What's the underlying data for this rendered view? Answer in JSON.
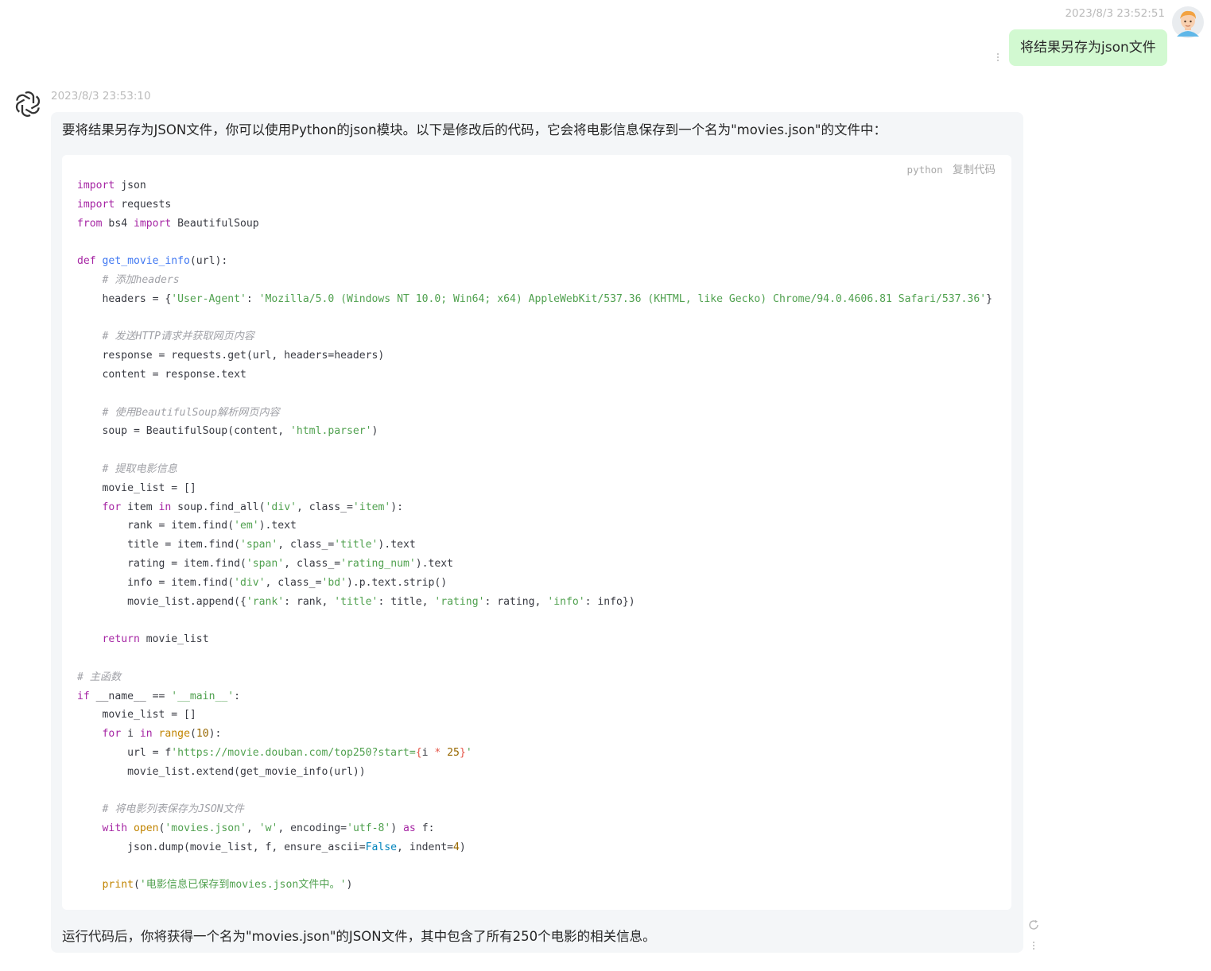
{
  "user_message": {
    "timestamp": "2023/8/3 23:52:51",
    "text": "将结果另存为json文件",
    "avatar_icon": "user-avatar-icon",
    "bubble_color": "#d2f9d1"
  },
  "assistant_message": {
    "timestamp": "2023/8/3 23:53:10",
    "avatar_icon": "openai-logo-icon",
    "intro": "要将结果另存为JSON文件，你可以使用Python的json模块。以下是修改后的代码，它会将电影信息保存到一个名为\"movies.json\"的文件中：",
    "code_block": {
      "language": "python",
      "copy_label": "复制代码",
      "lines": [
        "import json",
        "import requests",
        "from bs4 import BeautifulSoup",
        "",
        "def get_movie_info(url):",
        "    # 添加headers",
        "    headers = {'User-Agent': 'Mozilla/5.0 (Windows NT 10.0; Win64; x64) AppleWebKit/537.36 (KHTML, like Gecko) Chrome/94.0.4606.81 Safari/537.36'}",
        "",
        "    # 发送HTTP请求并获取网页内容",
        "    response = requests.get(url, headers=headers)",
        "    content = response.text",
        "",
        "    # 使用BeautifulSoup解析网页内容",
        "    soup = BeautifulSoup(content, 'html.parser')",
        "",
        "    # 提取电影信息",
        "    movie_list = []",
        "    for item in soup.find_all('div', class_='item'):",
        "        rank = item.find('em').text",
        "        title = item.find('span', class_='title').text",
        "        rating = item.find('span', class_='rating_num').text",
        "        info = item.find('div', class_='bd').p.text.strip()",
        "        movie_list.append({'rank': rank, 'title': title, 'rating': rating, 'info': info})",
        "",
        "    return movie_list",
        "",
        "# 主函数",
        "if __name__ == '__main__':",
        "    movie_list = []",
        "    for i in range(10):",
        "        url = f'https://movie.douban.com/top250?start={i * 25}'",
        "        movie_list.extend(get_movie_info(url))",
        "",
        "    # 将电影列表保存为JSON文件",
        "    with open('movies.json', 'w', encoding='utf-8') as f:",
        "        json.dump(movie_list, f, ensure_ascii=False, indent=4)",
        "",
        "    print('电影信息已保存到movies.json文件中。')"
      ]
    },
    "outro": "运行代码后，你将获得一个名为\"movies.json\"的JSON文件，其中包含了所有250个电影的相关信息。",
    "bubble_color": "#f4f6f8"
  },
  "icons": {
    "more": "more-vertical-icon",
    "regenerate": "regenerate-icon"
  }
}
